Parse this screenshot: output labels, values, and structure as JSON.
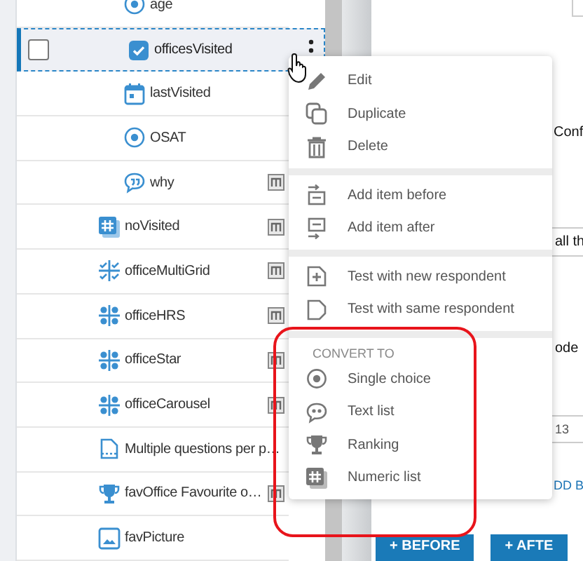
{
  "sidebar": {
    "items": [
      {
        "children": [
          {
            "label": "age",
            "kind": "radio",
            "selected": false,
            "has_list_badge": false
          },
          {
            "label": "officesVisited",
            "kind": "checkbox",
            "selected": true,
            "has_list_badge": false
          },
          {
            "label": "lastVisited",
            "kind": "calendar",
            "selected": false,
            "has_list_badge": false
          },
          {
            "label": "OSAT",
            "kind": "radio",
            "selected": false,
            "has_list_badge": false
          },
          {
            "label": "why",
            "kind": "quote",
            "selected": false,
            "has_list_badge": true
          }
        ]
      },
      {
        "label": "noVisited",
        "kind": "numeric",
        "selected": false,
        "has_list_badge": true
      },
      {
        "label": "officeMultiGrid",
        "kind": "multigrid",
        "selected": false,
        "has_list_badge": true
      },
      {
        "label": "officeHRS",
        "kind": "grid",
        "selected": false,
        "has_list_badge": true
      },
      {
        "label": "officeStar",
        "kind": "grid",
        "selected": false,
        "has_list_badge": true
      },
      {
        "label": "officeCarousel",
        "kind": "grid",
        "selected": false,
        "has_list_badge": true
      },
      {
        "label": "Multiple questions per p…",
        "kind": "page",
        "selected": false,
        "has_list_badge": false
      },
      {
        "label": "favOffice Favourite o…",
        "kind": "trophy",
        "selected": false,
        "has_list_badge": true
      },
      {
        "label": "favPicture",
        "kind": "image",
        "selected": false,
        "has_list_badge": false
      }
    ]
  },
  "background_texts": [
    "Conf",
    "all th",
    "ode",
    "13",
    "DD B"
  ],
  "background_buttons": [
    "+ BEFORE",
    "+ AFTE"
  ],
  "context_menu": {
    "groups": [
      {
        "items": [
          {
            "label": "Edit",
            "kind": "edit"
          },
          {
            "label": "Duplicate",
            "kind": "duplicate"
          },
          {
            "label": "Delete",
            "kind": "delete"
          }
        ]
      },
      {
        "items": [
          {
            "label": "Add item before",
            "kind": "before"
          },
          {
            "label": "Add item after",
            "kind": "after"
          }
        ]
      },
      {
        "items": [
          {
            "label": "Test with new respondent",
            "kind": "test-new"
          },
          {
            "label": "Test with same respondent",
            "kind": "test-same"
          }
        ]
      },
      {
        "heading": "CONVERT TO",
        "highlighted": true,
        "items": [
          {
            "label": "Single choice",
            "kind": "radio"
          },
          {
            "label": "Text list",
            "kind": "textlist"
          },
          {
            "label": "Ranking",
            "kind": "trophy"
          },
          {
            "label": "Numeric list",
            "kind": "numeric"
          }
        ]
      }
    ]
  }
}
